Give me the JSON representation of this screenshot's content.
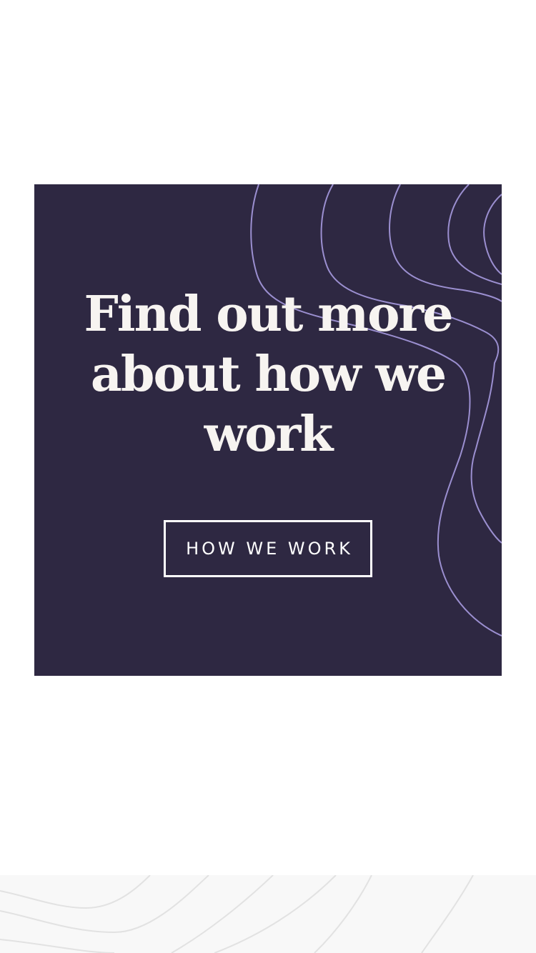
{
  "cta": {
    "heading": "Find out more about how we work",
    "button_label": "HOW WE WORK"
  },
  "colors": {
    "card_background": "#2e2842",
    "contour_line": "#9b8fd0",
    "heading_text": "#f7f4f1",
    "button_border": "#ffffff",
    "footer_background": "#f8f8f8",
    "footer_contour": "#e2e2e2"
  }
}
